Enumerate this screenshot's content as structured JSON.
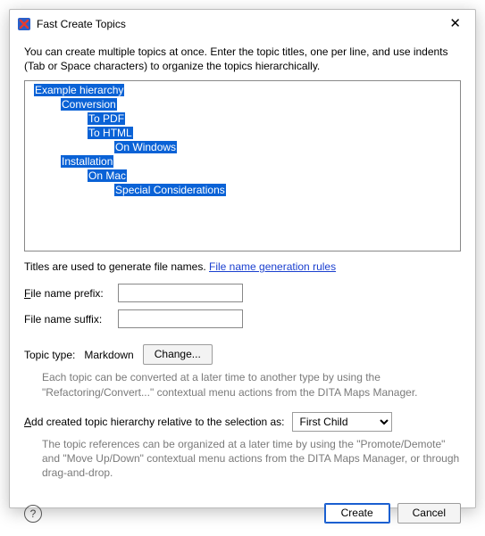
{
  "window": {
    "title": "Fast Create Topics"
  },
  "intro": "You can create multiple topics at once. Enter the topic titles, one per line, and use indents (Tab or Space characters) to organize the topics hierarchically.",
  "editor": {
    "lines": [
      {
        "indent": 0,
        "text": "Example hierarchy"
      },
      {
        "indent": 1,
        "text": "Conversion"
      },
      {
        "indent": 2,
        "text": "To PDF"
      },
      {
        "indent": 2,
        "text": "To HTML"
      },
      {
        "indent": 3,
        "text": "On Windows"
      },
      {
        "indent": 1,
        "text": "Installation"
      },
      {
        "indent": 2,
        "text": "On Mac"
      },
      {
        "indent": 3,
        "text": "Special Considerations"
      }
    ]
  },
  "filenames": {
    "note_prefix": "Titles are used to generate file names. ",
    "link_text": "File name generation rules",
    "prefix_label": "File name prefix:",
    "suffix_label": "File name suffix:",
    "prefix_value": "",
    "suffix_value": ""
  },
  "topic_type": {
    "label": "Topic type:",
    "value": "Markdown",
    "change_button": "Change...",
    "hint": "Each topic can be converted at a later time to another type by using the \"Refactoring/Convert...\" contextual menu actions from the DITA Maps Manager."
  },
  "add_hierarchy": {
    "label": "Add created topic hierarchy relative to the selection as:",
    "selected": "First Child",
    "hint": "The topic references can be organized at a later time by using the \"Promote/Demote\" and \"Move Up/Down\" contextual menu actions from the DITA Maps Manager, or through drag-and-drop."
  },
  "footer": {
    "create": "Create",
    "cancel": "Cancel"
  }
}
